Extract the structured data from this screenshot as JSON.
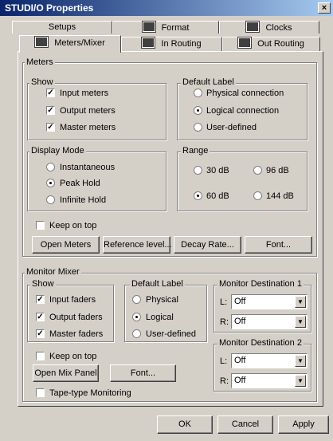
{
  "window": {
    "title": "STUDI/O Properties",
    "close_glyph": "×"
  },
  "tabs_row1": [
    "Setups",
    "Format",
    "Clocks"
  ],
  "tabs_row2": [
    "Meters/Mixer",
    "In Routing",
    "Out Routing"
  ],
  "meters": {
    "group_title": "Meters",
    "show": {
      "title": "Show",
      "items": [
        {
          "label": "Input meters",
          "checked": true
        },
        {
          "label": "Output meters",
          "checked": true
        },
        {
          "label": "Master meters",
          "checked": true
        }
      ]
    },
    "default_label": {
      "title": "Default Label",
      "items": [
        {
          "label": "Physical connection",
          "selected": false
        },
        {
          "label": "Logical connection",
          "selected": true
        },
        {
          "label": "User-defined",
          "selected": false
        }
      ]
    },
    "display_mode": {
      "title": "Display Mode",
      "items": [
        {
          "label": "Instantaneous",
          "selected": false
        },
        {
          "label": "Peak Hold",
          "selected": true
        },
        {
          "label": "Infinite Hold",
          "selected": false
        }
      ]
    },
    "range": {
      "title": "Range",
      "items": [
        {
          "label": "30 dB",
          "selected": false
        },
        {
          "label": "96 dB",
          "selected": false
        },
        {
          "label": "60 dB",
          "selected": true
        },
        {
          "label": "144 dB",
          "selected": false
        }
      ]
    },
    "keep_on_top": {
      "label": "Keep on top",
      "checked": false
    },
    "buttons": [
      "Open Meters",
      "Reference level...",
      "Decay Rate...",
      "Font..."
    ]
  },
  "mixer": {
    "group_title": "Monitor Mixer",
    "show": {
      "title": "Show",
      "items": [
        {
          "label": "Input faders",
          "checked": true
        },
        {
          "label": "Output faders",
          "checked": true
        },
        {
          "label": "Master faders",
          "checked": true
        }
      ]
    },
    "default_label": {
      "title": "Default Label",
      "items": [
        {
          "label": "Physical",
          "selected": false
        },
        {
          "label": "Logical",
          "selected": true
        },
        {
          "label": "User-defined",
          "selected": false
        }
      ]
    },
    "dest1": {
      "title": "Monitor Destination 1",
      "l_label": "L:",
      "l_value": "Off",
      "r_label": "R:",
      "r_value": "Off"
    },
    "dest2": {
      "title": "Monitor Destination 2",
      "l_label": "L:",
      "l_value": "Off",
      "r_label": "R:",
      "r_value": "Off"
    },
    "keep_on_top": {
      "label": "Keep on top",
      "checked": false
    },
    "buttons": [
      "Open Mix Panel",
      "Font..."
    ],
    "tape_monitoring": {
      "label": "Tape-type Monitoring",
      "checked": false
    }
  },
  "footer": {
    "ok": "OK",
    "cancel": "Cancel",
    "apply": "Apply"
  },
  "glyphs": {
    "check": "✓",
    "dropdown": "▼"
  }
}
